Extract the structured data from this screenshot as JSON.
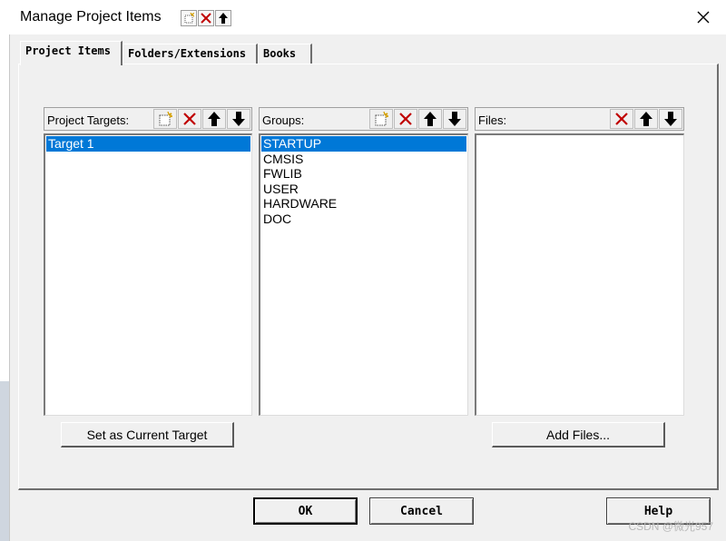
{
  "window": {
    "title": "Manage Project Items",
    "title_toolbar": [
      "new-icon",
      "delete-icon",
      "up-arrow-icon"
    ],
    "close_icon": "close-icon"
  },
  "tabs": [
    {
      "label": "Project Items",
      "active": true
    },
    {
      "label": "Folders/Extensions",
      "active": false
    },
    {
      "label": "Books",
      "active": false
    }
  ],
  "targets": {
    "label": "Project Targets:",
    "items": [
      "Target 1"
    ],
    "selected_index": 0,
    "tools": [
      "new-icon",
      "delete-icon",
      "up-arrow-icon",
      "down-arrow-icon"
    ]
  },
  "groups": {
    "label": "Groups:",
    "items": [
      "STARTUP",
      "CMSIS",
      "FWLIB",
      "USER",
      "HARDWARE",
      "DOC"
    ],
    "selected_index": 0,
    "tools": [
      "new-icon",
      "delete-icon",
      "up-arrow-icon",
      "down-arrow-icon"
    ]
  },
  "files": {
    "label": "Files:",
    "items": [],
    "tools": [
      "delete-icon",
      "up-arrow-icon",
      "down-arrow-icon"
    ]
  },
  "buttons": {
    "set_current": "Set as Current Target",
    "add_files": "Add Files...",
    "ok": "OK",
    "cancel": "Cancel",
    "help": "Help"
  },
  "watermark": "CSDN @微光957",
  "colors": {
    "selection": "#0078d7",
    "delete_icon": "#c00000",
    "dialog_bg": "#f0f0f0"
  }
}
